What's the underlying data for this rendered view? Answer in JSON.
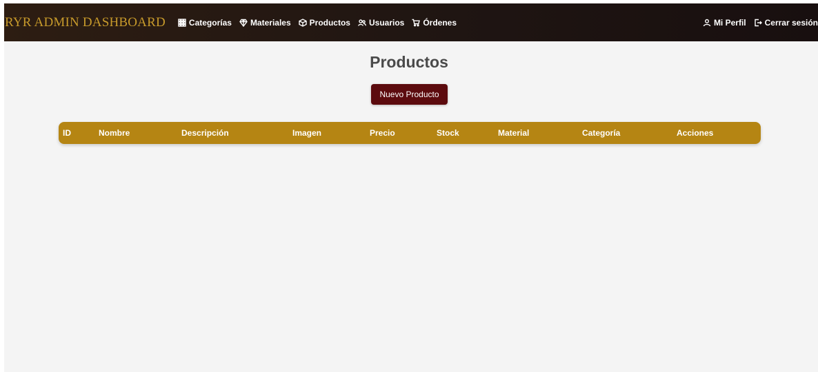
{
  "navbar": {
    "brand": "RYR ADMIN DASHBOARD",
    "links": [
      {
        "label": "Categorías",
        "icon": "grid-icon"
      },
      {
        "label": "Materiales",
        "icon": "diamond-icon"
      },
      {
        "label": "Productos",
        "icon": "box-icon"
      },
      {
        "label": "Usuarios",
        "icon": "users-icon"
      },
      {
        "label": "Órdenes",
        "icon": "cart-icon"
      }
    ],
    "right": [
      {
        "label": "Mi Perfil",
        "icon": "user-icon"
      },
      {
        "label": "Cerrar sesión",
        "icon": "logout-icon"
      }
    ]
  },
  "page": {
    "title": "Productos",
    "new_button": "Nuevo Producto"
  },
  "table": {
    "columns": [
      "ID",
      "Nombre",
      "Descripción",
      "Imagen",
      "Precio",
      "Stock",
      "Material",
      "Categoría",
      "Acciones"
    ],
    "rows": []
  },
  "colors": {
    "brand": "#c79a2b",
    "header": "#b58513",
    "button": "#5c0b0e",
    "navbar": "#1f1512",
    "background": "#f4f4f4"
  }
}
